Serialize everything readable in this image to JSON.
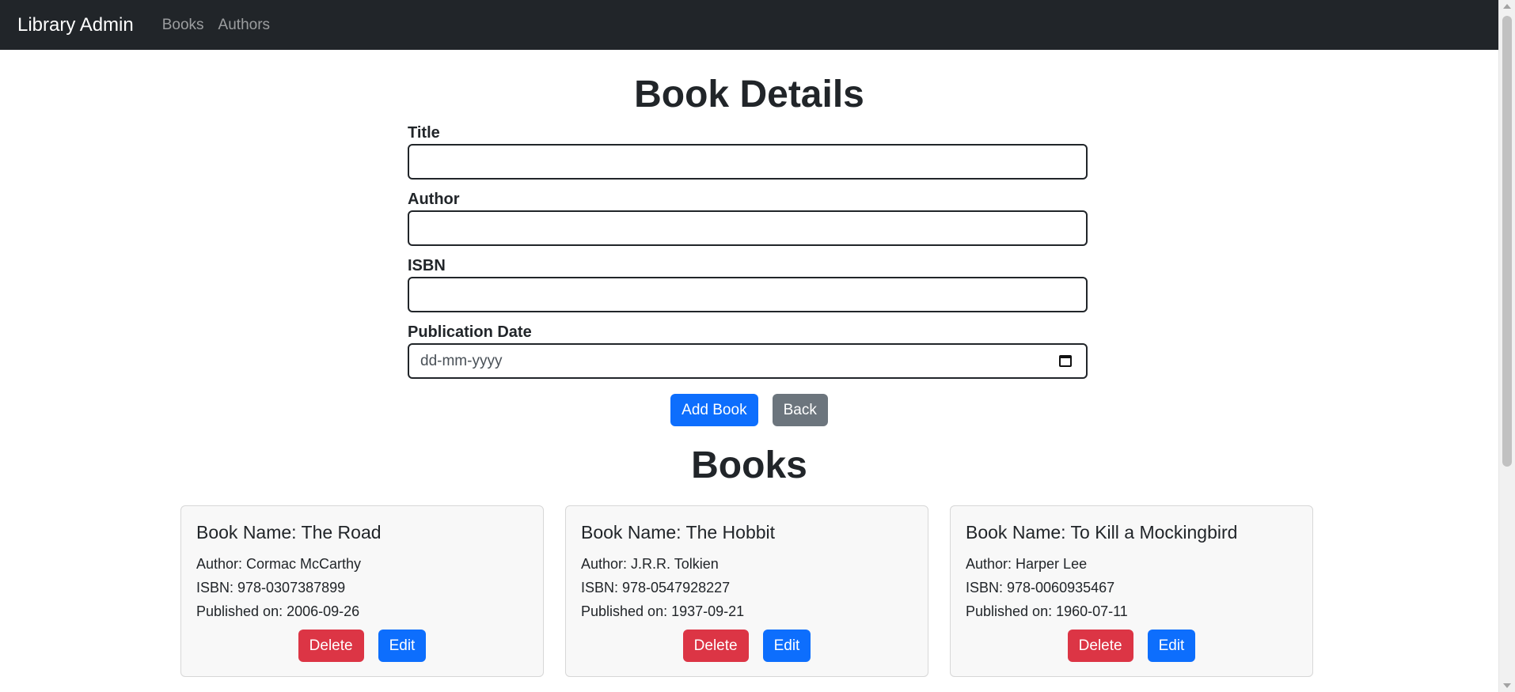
{
  "navbar": {
    "brand": "Library Admin",
    "links": [
      "Books",
      "Authors"
    ]
  },
  "form": {
    "title": "Book Details",
    "fields": {
      "title": {
        "label": "Title",
        "value": ""
      },
      "author": {
        "label": "Author",
        "value": ""
      },
      "isbn": {
        "label": "ISBN",
        "value": ""
      },
      "publication_date": {
        "label": "Publication Date",
        "placeholder": "dd-mm-yyyy"
      }
    },
    "add_label": "Add Book",
    "back_label": "Back"
  },
  "books_heading": "Books",
  "books": [
    {
      "name": "Book Name: The Road",
      "author": "Author: Cormac McCarthy",
      "isbn": "ISBN: 978-0307387899",
      "published": "Published on: 2006-09-26",
      "delete_label": "Delete",
      "edit_label": "Edit"
    },
    {
      "name": "Book Name: The Hobbit",
      "author": "Author: J.R.R. Tolkien",
      "isbn": "ISBN: 978-0547928227",
      "published": "Published on: 1937-09-21",
      "delete_label": "Delete",
      "edit_label": "Edit"
    },
    {
      "name": "Book Name: To Kill a Mockingbird",
      "author": "Author: Harper Lee",
      "isbn": "ISBN: 978-0060935467",
      "published": "Published on: 1960-07-11",
      "delete_label": "Delete",
      "edit_label": "Edit"
    }
  ],
  "colors": {
    "navbar": "#212529",
    "primary": "#0d6efd",
    "secondary": "#6c757d",
    "danger": "#dc3545"
  },
  "icons": {
    "date_picker": "calendar-icon"
  }
}
